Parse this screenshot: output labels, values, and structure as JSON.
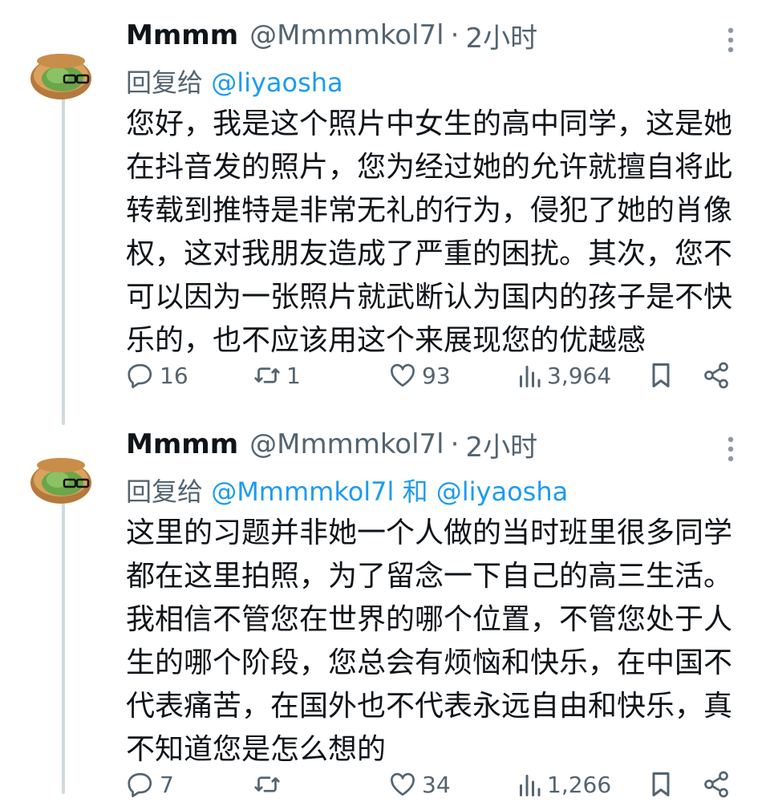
{
  "tweets": [
    {
      "display_name": "Mmmm",
      "handle": "@Mmmmkol7l",
      "separator": "·",
      "time": "2小时",
      "reply_prefix": "回复给",
      "reply_mentions": "@liyaosha",
      "text": "您好，我是这个照片中女生的高中同学，这是她在抖音发的照片，您为经过她的允许就擅自将此转载到推特是非常无礼的行为，侵犯了她的肖像权，这对我朋友造成了严重的困扰。其次，您不可以因为一张照片就武断认为国内的孩子是不快乐的，也不应该用这个来展现您的优越感",
      "replies": "16",
      "retweets": "1",
      "likes": "93",
      "views": "3,964"
    },
    {
      "display_name": "Mmmm",
      "handle": "@Mmmmkol7l",
      "separator": "·",
      "time": "2小时",
      "reply_prefix": "回复给",
      "reply_mentions": "@Mmmmkol7l 和 @liyaosha",
      "text": "这里的习题并非她一个人做的当时班里很多同学都在这里拍照，为了留念一下自己的高三生活。我相信不管您在世界的哪个位置，不管您处于人生的哪个阶段，您总会有烦恼和快乐，在中国不代表痛苦，在国外也不代表永远自由和快乐，真不知道您是怎么想的",
      "replies": "7",
      "retweets": "",
      "likes": "34",
      "views": "1,266"
    }
  ],
  "icons": {
    "avatar": "avatar-cartoon-icon",
    "more": "more-vertical-icon",
    "reply": "reply-icon",
    "retweet": "retweet-icon",
    "like": "heart-icon",
    "views": "views-chart-icon",
    "bookmark": "bookmark-icon",
    "share": "share-icon"
  },
  "colors": {
    "text": "#0f1419",
    "secondary": "#536471",
    "link": "#1d9bf0",
    "thread_line": "#cfd9de"
  }
}
